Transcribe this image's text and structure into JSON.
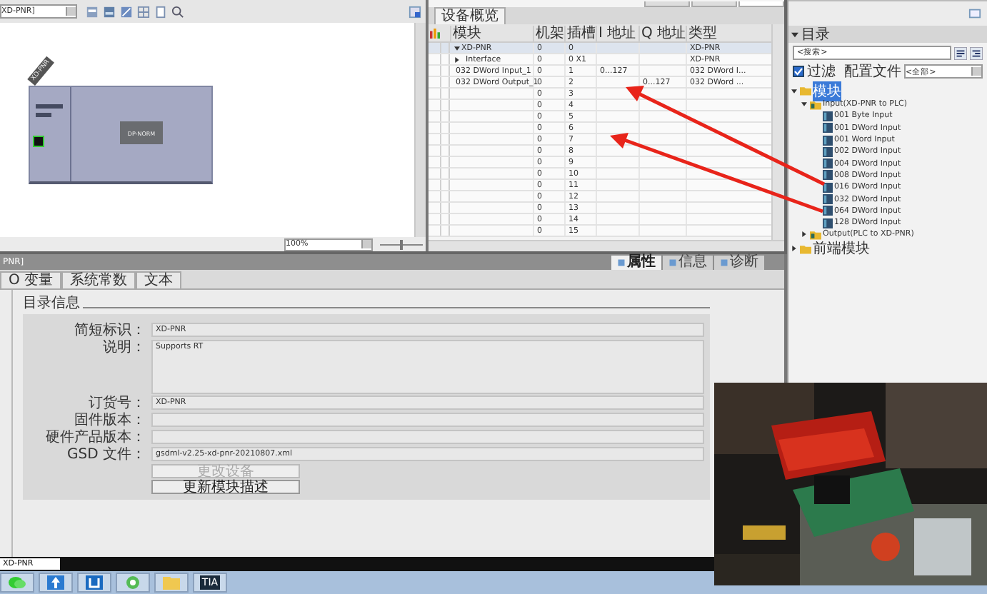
{
  "view_tabs": [
    {
      "selected": false
    },
    {
      "selected": false
    },
    {
      "selected": true
    }
  ],
  "graphic": {
    "device_select": "XD-PNR]",
    "device_label": "XD-PNR",
    "module_label": "DP-NORM",
    "zoom": "100%",
    "zoom_slider": {
      "level": 0.5
    }
  },
  "overview": {
    "tab": "设备概览",
    "columns": [
      "模块",
      "机架",
      "插槽",
      "I 地址",
      "Q 地址",
      "类型"
    ],
    "rows": [
      {
        "module": "XD-PNR",
        "expanded": true,
        "rack": "0",
        "slot": "0",
        "type": "XD-PNR",
        "selected": true
      },
      {
        "module": "Interface",
        "expanded": false,
        "rack": "0",
        "slot": "0 X1",
        "type": "XD-PNR",
        "selected": false
      },
      {
        "module": "032 DWord Input_1",
        "rack": "0",
        "slot": "1",
        "i_address": "0...127",
        "type": "032 DWord I...",
        "selected": false
      },
      {
        "module": "032 DWord Output_1",
        "rack": "0",
        "slot": "2",
        "q_address": "0...127",
        "type": "032 DWord ...",
        "selected": false
      },
      {
        "rack": "0",
        "slot": "3",
        "selected": false
      },
      {
        "rack": "0",
        "slot": "4",
        "selected": false
      },
      {
        "rack": "0",
        "slot": "5",
        "selected": false
      },
      {
        "rack": "0",
        "slot": "6",
        "selected": false
      },
      {
        "rack": "0",
        "slot": "7",
        "selected": false
      },
      {
        "rack": "0",
        "slot": "8",
        "selected": false
      },
      {
        "rack": "0",
        "slot": "9",
        "selected": false
      },
      {
        "rack": "0",
        "slot": "10",
        "selected": false
      },
      {
        "rack": "0",
        "slot": "11",
        "selected": false
      },
      {
        "rack": "0",
        "slot": "12",
        "selected": false
      },
      {
        "rack": "0",
        "slot": "13",
        "selected": false
      },
      {
        "rack": "0",
        "slot": "14",
        "selected": false
      },
      {
        "rack": "0",
        "slot": "15",
        "selected": false
      }
    ]
  },
  "catalog": {
    "title": "目录",
    "search": {
      "placeholder": "<搜索>"
    },
    "filter": {
      "label": "过滤",
      "checked": true
    },
    "profile_label": "配置文件",
    "profile": "<全部>",
    "tree": [
      {
        "label": "模块",
        "selected": true,
        "expanded": true,
        "children": [
          {
            "label": "Input(XD-PNR to PLC)",
            "selected": false,
            "expanded": true,
            "children": [
              {
                "label": "001 Byte Input",
                "selected": false
              },
              {
                "label": "001 DWord Input",
                "selected": false
              },
              {
                "label": "001 Word Input",
                "selected": false
              },
              {
                "label": "002 DWord Input",
                "selected": false
              },
              {
                "label": "004 DWord Input",
                "selected": false
              },
              {
                "label": "008 DWord Input",
                "selected": false
              },
              {
                "label": "016 DWord Input",
                "selected": false
              },
              {
                "label": "032 DWord Input",
                "selected": false
              },
              {
                "label": "064 DWord Input",
                "selected": false
              },
              {
                "label": "128 DWord Input",
                "selected": false
              }
            ]
          },
          {
            "label": "Output(PLC to XD-PNR)",
            "selected": false,
            "expanded": false
          }
        ]
      },
      {
        "label": "前端模块",
        "selected": false,
        "expanded": false
      }
    ]
  },
  "properties": {
    "title": "PNR]",
    "tabs": [
      "O 变量",
      "系统常数",
      "文本"
    ],
    "inspector_tabs": [
      {
        "label": "属性",
        "selected": true
      },
      {
        "label": "信息",
        "selected": false
      },
      {
        "label": "诊断",
        "selected": false
      }
    ],
    "section": "目录信息",
    "fields": [
      {
        "label": "简短标识：",
        "value": "XD-PNR",
        "kind": "line"
      },
      {
        "label": "说明：",
        "value": "Supports RT",
        "kind": "area"
      },
      {
        "label": "订货号：",
        "value": "XD-PNR",
        "kind": "line"
      },
      {
        "label": "固件版本：",
        "kind": "line"
      },
      {
        "label": "硬件产品版本：",
        "kind": "line"
      },
      {
        "label": "GSD 文件：",
        "value": "gsdml-v2.25-xd-pnr-20210807.xml",
        "kind": "line"
      }
    ],
    "buttons": [
      {
        "label": "更改设备",
        "disabled": true
      },
      {
        "label": "更新模块描述",
        "disabled": false
      }
    ]
  },
  "status_bar": {
    "field": "XD-PNR"
  },
  "taskbar": [
    {
      "kind": "chat"
    },
    {
      "kind": "arrow"
    },
    {
      "kind": "bracket"
    },
    {
      "kind": "circle"
    },
    {
      "kind": "folder"
    },
    {
      "kind": "tia",
      "label": "TIA"
    }
  ]
}
